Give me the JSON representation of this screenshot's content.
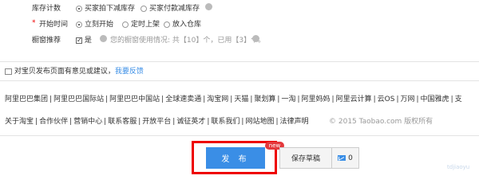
{
  "form": {
    "stock": {
      "label": "库存计数",
      "options": [
        "买家拍下减库存",
        "买家付款减库存"
      ],
      "selected_index": 0
    },
    "start_time": {
      "label": "开始时间",
      "required_mark": "*",
      "options": [
        "立刻开始",
        "定时上架",
        "放入仓库"
      ],
      "selected_index": 0
    },
    "showcase": {
      "label": "橱窗推荐",
      "checkbox_label": "是",
      "checked": true,
      "info_prefix": "您的橱窗使用情况: 共",
      "total": "【10】",
      "middle": "个，已用",
      "used": "【3】",
      "suffix": "个。"
    }
  },
  "feedback": {
    "text": "对宝贝发布页面有意见或建议，",
    "link": "我要反馈"
  },
  "footer": {
    "sites": [
      "阿里巴巴集团",
      "阿里巴巴国际站",
      "阿里巴巴中国站",
      "全球速卖通",
      "淘宝网",
      "天猫",
      "聚划算",
      "一淘",
      "阿里妈妈",
      "阿里云计算",
      "云OS",
      "万网",
      "中国雅虎",
      "支"
    ],
    "links": [
      "关于淘宝",
      "合作伙伴",
      "营销中心",
      "联系客服",
      "开放平台",
      "诚征英才",
      "联系我们",
      "网站地图",
      "法律声明"
    ],
    "copyright": "© 2015 Taobao.com 版权所有"
  },
  "actions": {
    "publish": "发 布",
    "badge": "new",
    "save_draft": "保存草稿",
    "message_count": "0"
  },
  "colors": {
    "accent": "#3a8ee6",
    "highlight": "#e00000"
  },
  "watermark": "tdjiaoyu"
}
